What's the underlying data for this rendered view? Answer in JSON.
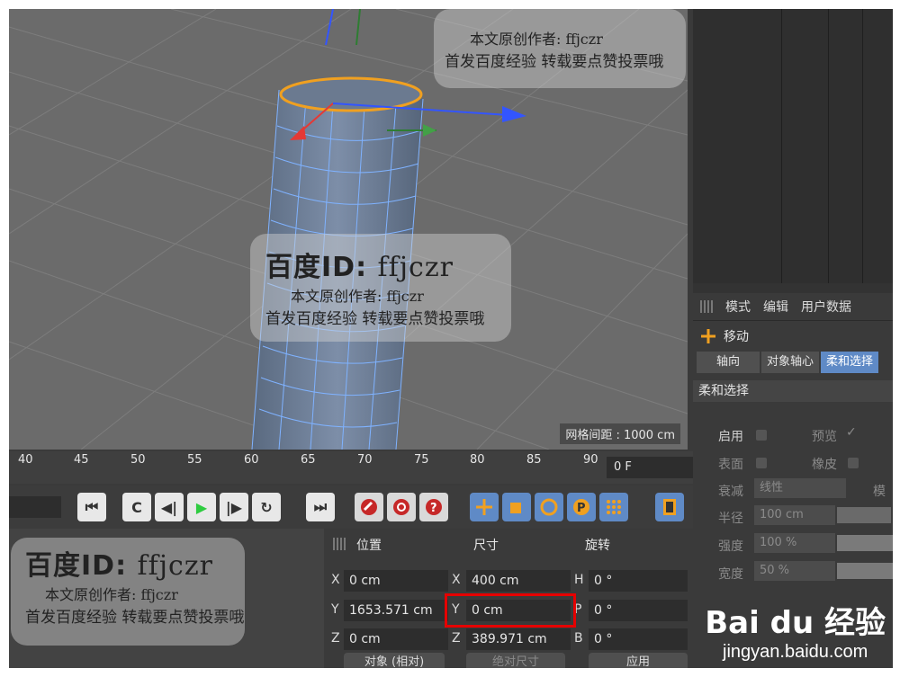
{
  "viewport": {
    "grid_spacing_label": "网格间距 : 1000 cm"
  },
  "timeline": {
    "ticks": [
      "40",
      "45",
      "50",
      "55",
      "60",
      "65",
      "70",
      "75",
      "80",
      "85",
      "90"
    ],
    "current_frame": "0 F"
  },
  "transport": {
    "buttons": [
      "⏮",
      "C",
      "◀|",
      "▶",
      "|▶",
      "↻",
      "⏭"
    ]
  },
  "attributes": {
    "menu": [
      "模式",
      "编辑",
      "用户数据"
    ],
    "tool_name": "移动",
    "tabs": [
      "轴向",
      "对象轴心",
      "柔和选择"
    ],
    "section_title": "柔和选择",
    "props": {
      "enable_label": "启用",
      "preview_label": "预览",
      "surface_label": "表面",
      "rubber_label": "橡皮",
      "falloff_label": "衰减",
      "falloff_value": "线性",
      "mode_label": "模",
      "radius_label": "半径",
      "radius_value": "100 cm",
      "strength_label": "强度",
      "strength_value": "100 %",
      "width_label": "宽度",
      "width_value": "50 %"
    }
  },
  "coordinates": {
    "headers": {
      "position": "位置",
      "size": "尺寸",
      "rotation": "旋转"
    },
    "position": {
      "x_label": "X",
      "x": "0 cm",
      "y_label": "Y",
      "y": "1653.571 cm",
      "z_label": "Z",
      "z": "0 cm"
    },
    "size": {
      "x_label": "X",
      "x": "400 cm",
      "y_label": "Y",
      "y": "0 cm",
      "z_label": "Z",
      "z": "389.971 cm"
    },
    "rotation": {
      "h_label": "H",
      "h": "0 °",
      "p_label": "P",
      "p": "0 °",
      "b_label": "B",
      "b": "0 °"
    },
    "mode_dropdown": "对象 (相对)",
    "size_mode_dropdown": "绝对尺寸",
    "apply_button": "应用"
  },
  "watermark": {
    "line1_prefix": "百度ID:",
    "line1_id": "ffjczr",
    "line2": "本文原创作者: ffjczr",
    "line3": "首发百度经验 转载要点赞投票哦"
  },
  "baidu_logo": {
    "brand": "Bai du 经验",
    "url": "jingyan.baidu.com"
  },
  "colors": {
    "highlight": "#e60000",
    "accent": "#5f8ac6",
    "selection": "#f0a020"
  }
}
